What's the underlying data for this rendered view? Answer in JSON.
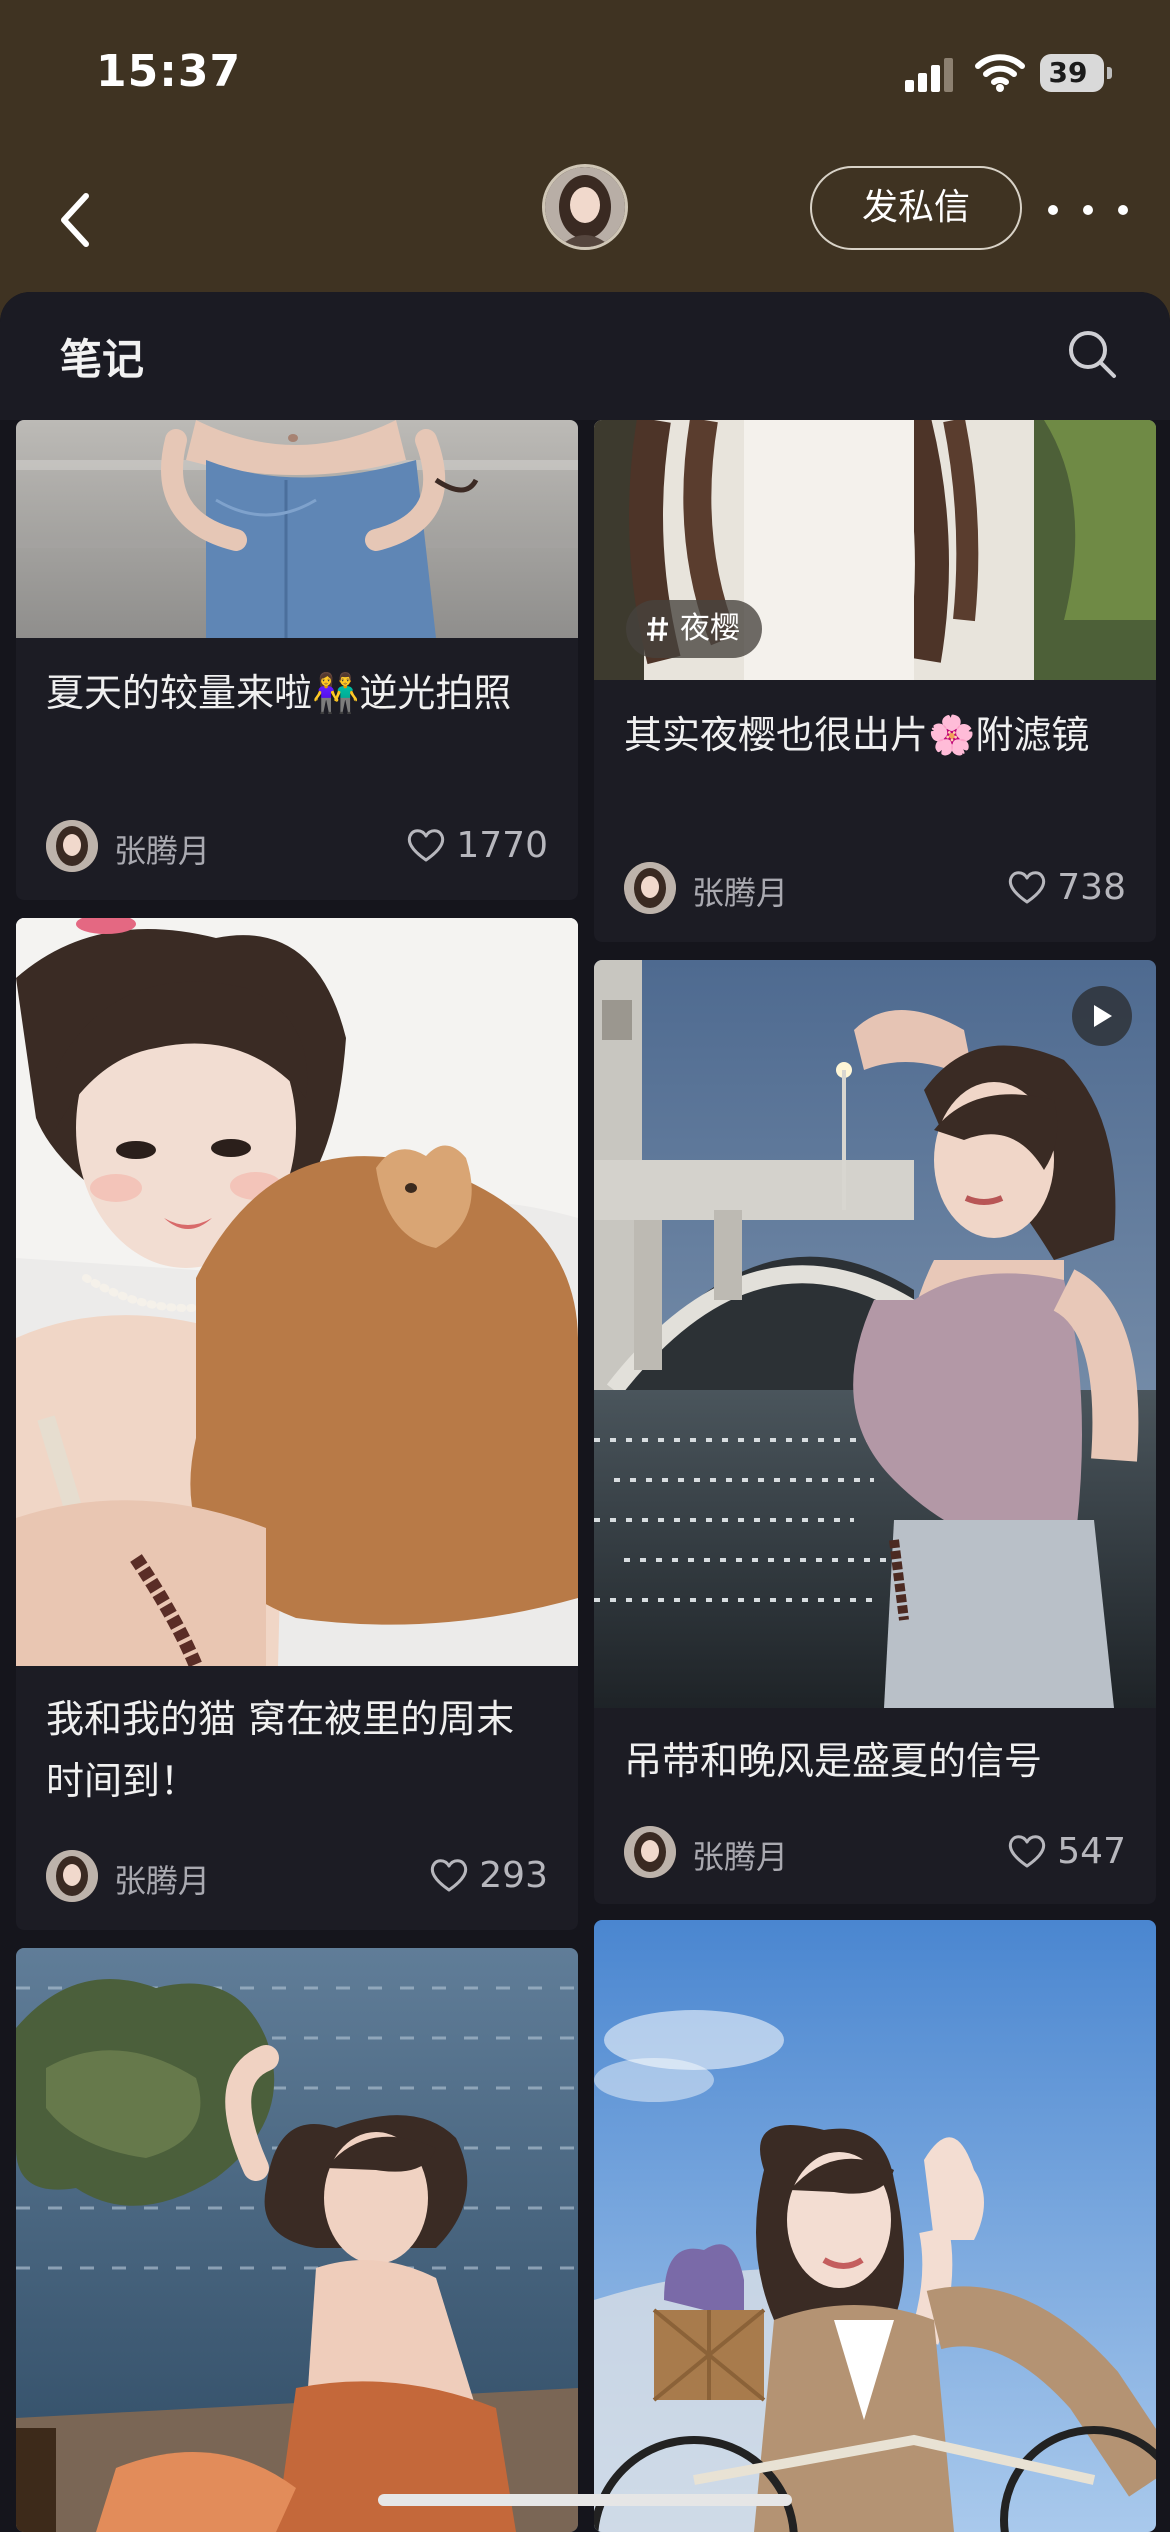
{
  "status_bar": {
    "time": "15:37",
    "battery": "39"
  },
  "header": {
    "back_icon": "chevron-left-icon",
    "message_button": "发私信",
    "more_icon": "more-dots-icon"
  },
  "section": {
    "title": "笔记",
    "search_icon": "search-icon"
  },
  "notes": [
    {
      "title": "夏天的较量来啦👫逆光拍照",
      "author": "张腾月",
      "likes": "1770"
    },
    {
      "tag": "夜樱",
      "title": "其实夜樱也很出片🌸附滤镜",
      "author": "张腾月",
      "likes": "738"
    },
    {
      "title": "我和我的猫 窝在被里的周末时间到！",
      "author": "张腾月",
      "likes": "293"
    },
    {
      "title": "吊带和晚风是盛夏的信号",
      "author": "张腾月",
      "likes": "547",
      "video": true
    },
    {
      "title": "",
      "author": "",
      "likes": ""
    },
    {
      "title": "",
      "author": "",
      "likes": ""
    }
  ],
  "colors": {
    "header_bg": "#3f3322",
    "page_bg": "#15151c",
    "card_bg": "#1c1c24",
    "text_primary": "#f0f0f0",
    "text_secondary": "#a9a9b0"
  }
}
